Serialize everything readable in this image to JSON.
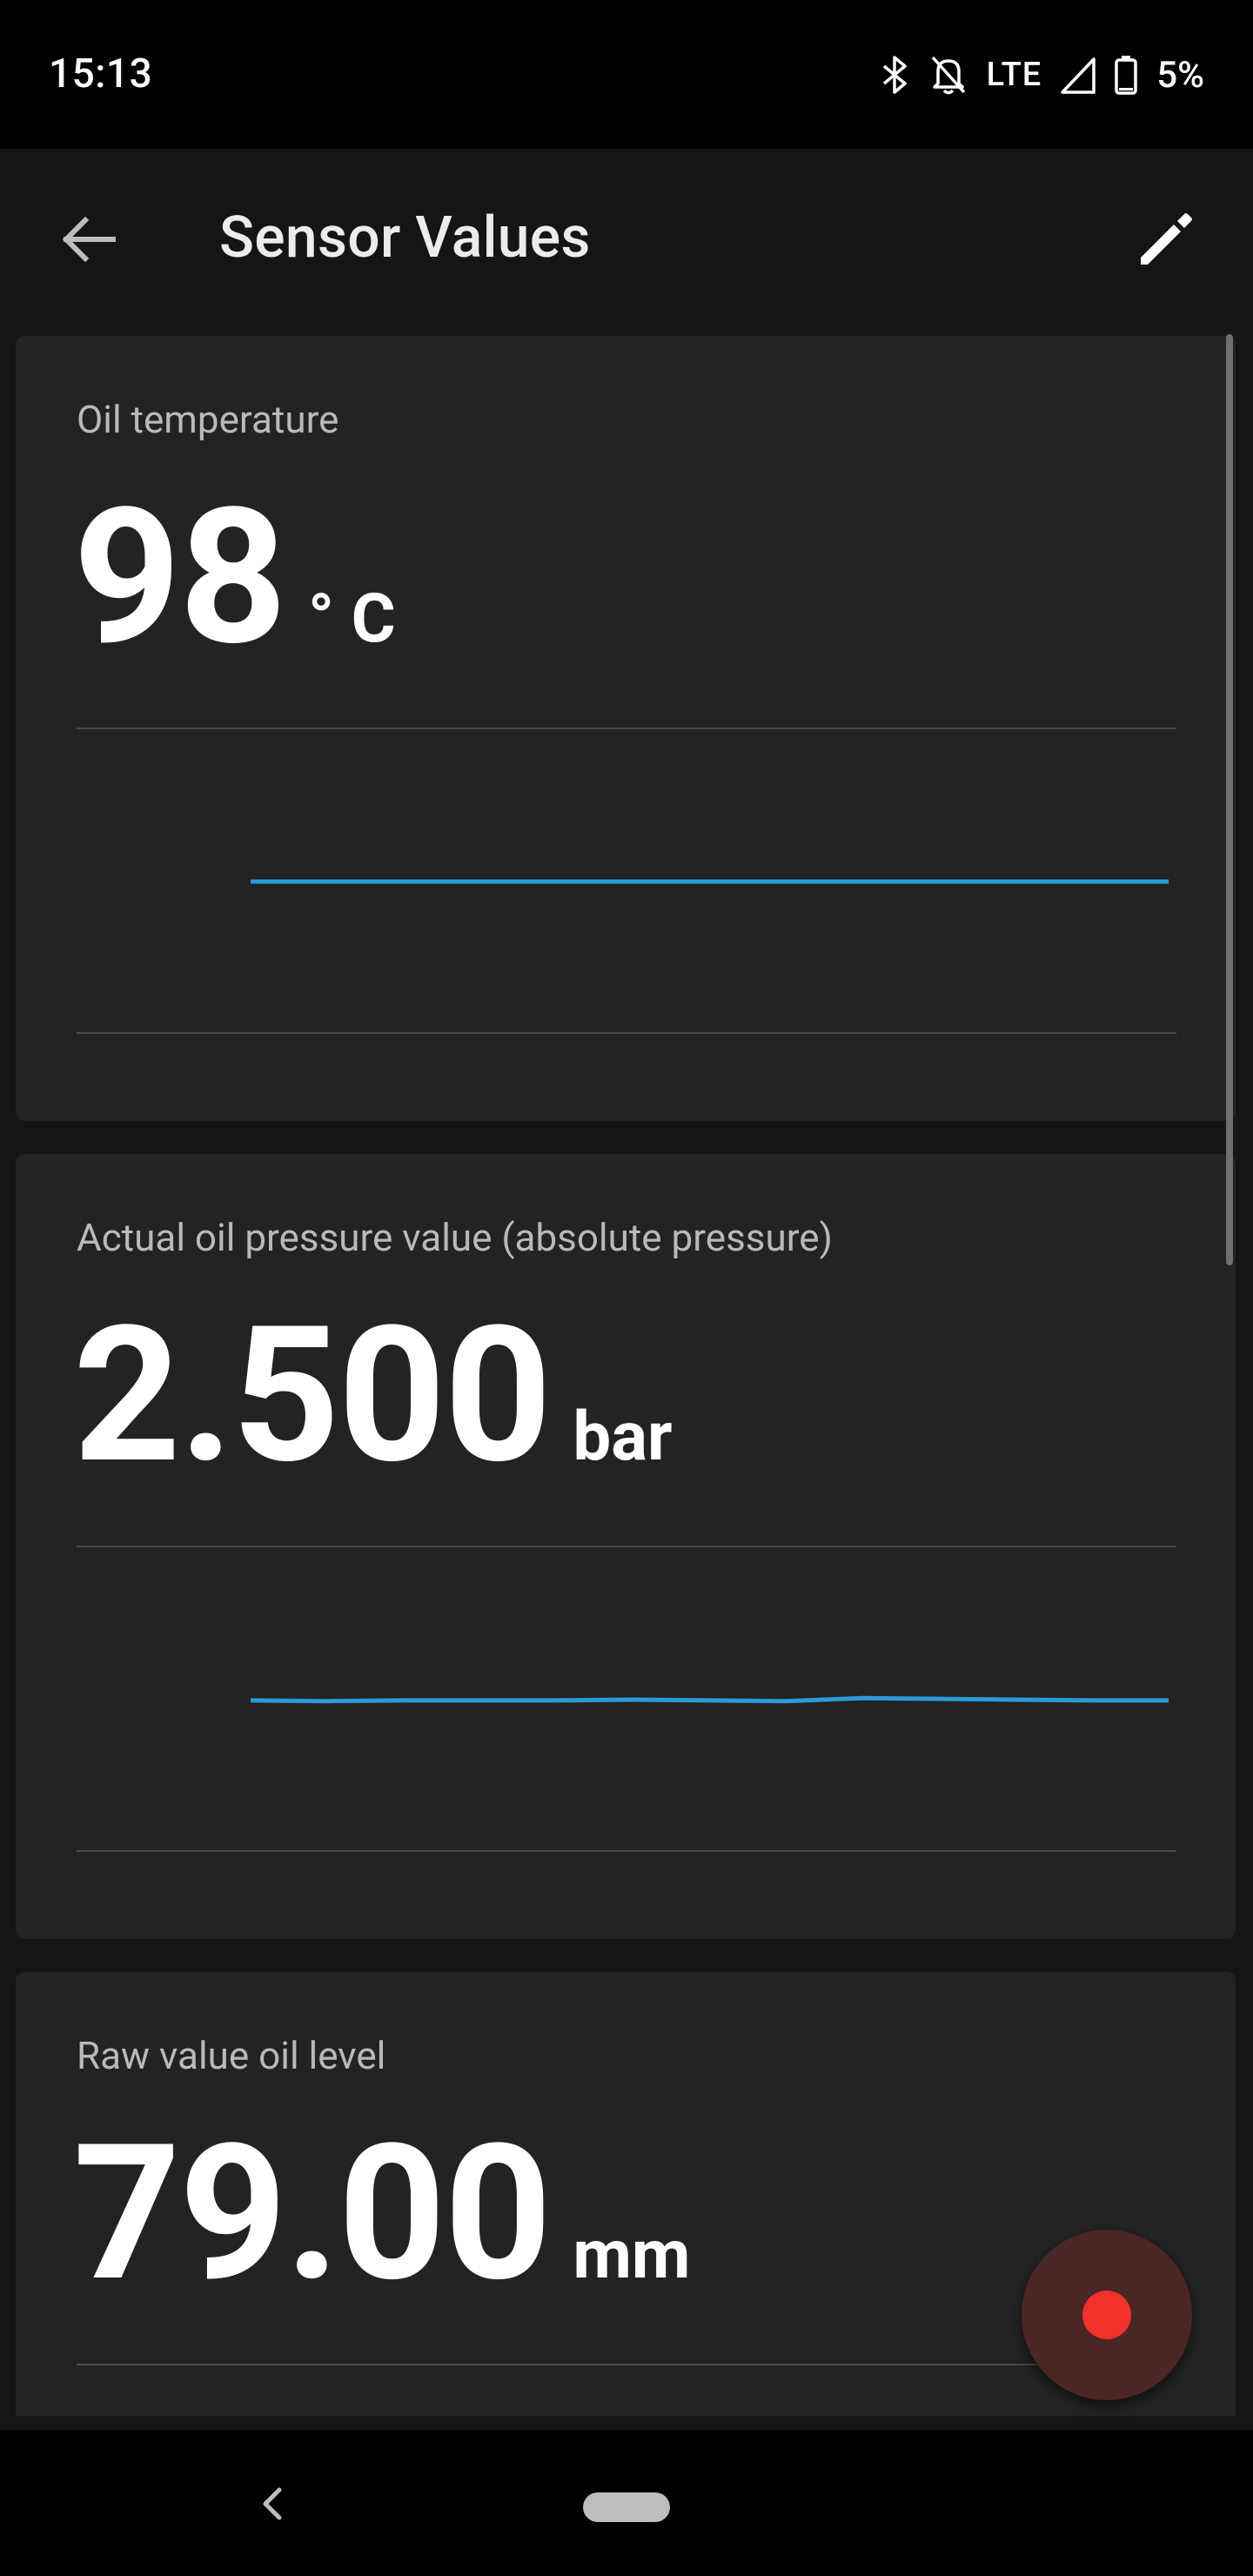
{
  "status_bar": {
    "time": "15:13",
    "network": "LTE",
    "battery": "5%",
    "icons": [
      "bluetooth-icon",
      "bell-off-icon",
      "signal-icon",
      "battery-icon"
    ]
  },
  "app_bar": {
    "title": "Sensor Values",
    "icons": [
      "back-arrow-icon",
      "edit-pencil-icon"
    ]
  },
  "sensors": [
    {
      "label": "Oil temperature",
      "value": "98",
      "unit": "° C",
      "trend": [
        98,
        98,
        98,
        98,
        98,
        98,
        98,
        98,
        98,
        98
      ]
    },
    {
      "label": "Actual oil pressure value (absolute pressure)",
      "value": "2.500",
      "unit": "bar",
      "trend": [
        2.5,
        2.499,
        2.5,
        2.5,
        2.5,
        2.501,
        2.5,
        2.499,
        2.503,
        2.502,
        2.501,
        2.5,
        2.5
      ]
    },
    {
      "label": "Raw value oil level",
      "value": "79.00",
      "unit": "mm"
    }
  ],
  "fab": {
    "icon": "record-dot-icon",
    "color": "#f0312c"
  },
  "accent_color": "#2a9bd8",
  "nav_bar": {
    "icons": [
      "nav-back-icon",
      "home-pill"
    ]
  }
}
